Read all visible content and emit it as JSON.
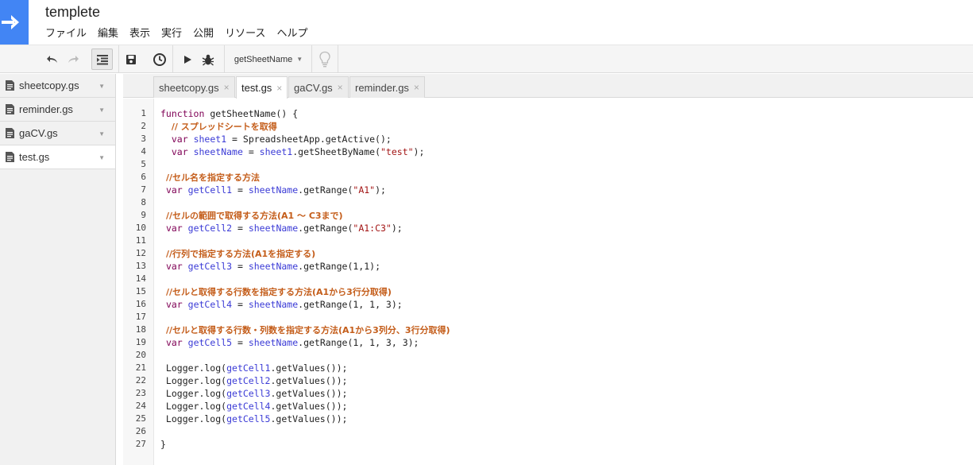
{
  "app": {
    "title": "templete",
    "colors": {
      "brand": "#4285f4",
      "comment": "#c45d1a",
      "keyword": "#7f0055",
      "variable": "#3b3bd6",
      "string": "#a31515"
    }
  },
  "menu": [
    "ファイル",
    "編集",
    "表示",
    "実行",
    "公開",
    "リソース",
    "ヘルプ"
  ],
  "toolbar": {
    "function_select": "getSheetName",
    "icons": [
      "undo-icon",
      "redo-icon",
      "indent-icon",
      "save-icon",
      "triggers-icon",
      "run-icon",
      "debug-icon",
      "lightbulb-icon"
    ]
  },
  "sidebar": {
    "files": [
      {
        "name": "sheetcopy.gs"
      },
      {
        "name": "reminder.gs"
      },
      {
        "name": "gaCV.gs"
      },
      {
        "name": "test.gs"
      }
    ],
    "active_index": 3
  },
  "tabs": [
    {
      "label": "sheetcopy.gs",
      "close": "×"
    },
    {
      "label": "test.gs",
      "close": "×"
    },
    {
      "label": "gaCV.gs",
      "close": "×"
    },
    {
      "label": "reminder.gs",
      "close": "×"
    }
  ],
  "active_tab": 1,
  "code": [
    [
      [
        "kw",
        "function"
      ],
      [
        "t",
        " getSheetName() {"
      ]
    ],
    [
      [
        "t",
        "  "
      ],
      [
        "c",
        "// スプレッドシートを取得"
      ]
    ],
    [
      [
        "t",
        "  "
      ],
      [
        "kw",
        "var"
      ],
      [
        "t",
        " "
      ],
      [
        "v",
        "sheet1"
      ],
      [
        "t",
        " = SpreadsheetApp.getActive();"
      ]
    ],
    [
      [
        "t",
        "  "
      ],
      [
        "kw",
        "var"
      ],
      [
        "t",
        " "
      ],
      [
        "v",
        "sheetName"
      ],
      [
        "t",
        " = "
      ],
      [
        "v",
        "sheet1"
      ],
      [
        "t",
        ".getSheetByName("
      ],
      [
        "s",
        "\"test\""
      ],
      [
        "t",
        ");"
      ]
    ],
    [
      [
        "t",
        ""
      ]
    ],
    [
      [
        "t",
        " "
      ],
      [
        "c",
        "//セル名を指定する方法"
      ]
    ],
    [
      [
        "t",
        " "
      ],
      [
        "kw",
        "var"
      ],
      [
        "t",
        " "
      ],
      [
        "v",
        "getCell1"
      ],
      [
        "t",
        " = "
      ],
      [
        "v",
        "sheetName"
      ],
      [
        "t",
        ".getRange("
      ],
      [
        "s",
        "\"A1\""
      ],
      [
        "t",
        ");"
      ]
    ],
    [
      [
        "t",
        ""
      ]
    ],
    [
      [
        "t",
        " "
      ],
      [
        "c",
        "//セルの範囲で取得する方法(A1 〜 C3まで)"
      ]
    ],
    [
      [
        "t",
        " "
      ],
      [
        "kw",
        "var"
      ],
      [
        "t",
        " "
      ],
      [
        "v",
        "getCell2"
      ],
      [
        "t",
        " = "
      ],
      [
        "v",
        "sheetName"
      ],
      [
        "t",
        ".getRange("
      ],
      [
        "s",
        "\"A1:C3\""
      ],
      [
        "t",
        ");"
      ]
    ],
    [
      [
        "t",
        ""
      ]
    ],
    [
      [
        "t",
        " "
      ],
      [
        "c",
        "//行列で指定する方法(A1を指定する)"
      ]
    ],
    [
      [
        "t",
        " "
      ],
      [
        "kw",
        "var"
      ],
      [
        "t",
        " "
      ],
      [
        "v",
        "getCell3"
      ],
      [
        "t",
        " = "
      ],
      [
        "v",
        "sheetName"
      ],
      [
        "t",
        ".getRange(1,1);"
      ]
    ],
    [
      [
        "t",
        ""
      ]
    ],
    [
      [
        "t",
        " "
      ],
      [
        "c",
        "//セルと取得する行数を指定する方法(A1から3行分取得)"
      ]
    ],
    [
      [
        "t",
        " "
      ],
      [
        "kw",
        "var"
      ],
      [
        "t",
        " "
      ],
      [
        "v",
        "getCell4"
      ],
      [
        "t",
        " = "
      ],
      [
        "v",
        "sheetName"
      ],
      [
        "t",
        ".getRange(1, 1, 3);"
      ]
    ],
    [
      [
        "t",
        ""
      ]
    ],
    [
      [
        "t",
        " "
      ],
      [
        "c",
        "//セルと取得する行数・列数を指定する方法(A1から3列分、3行分取得)"
      ]
    ],
    [
      [
        "t",
        " "
      ],
      [
        "kw",
        "var"
      ],
      [
        "t",
        " "
      ],
      [
        "v",
        "getCell5"
      ],
      [
        "t",
        " = "
      ],
      [
        "v",
        "sheetName"
      ],
      [
        "t",
        ".getRange(1, 1, 3, 3);"
      ]
    ],
    [
      [
        "t",
        ""
      ]
    ],
    [
      [
        "t",
        " Logger.log("
      ],
      [
        "v",
        "getCell1"
      ],
      [
        "t",
        ".getValues());"
      ]
    ],
    [
      [
        "t",
        " Logger.log("
      ],
      [
        "v",
        "getCell2"
      ],
      [
        "t",
        ".getValues());"
      ]
    ],
    [
      [
        "t",
        " Logger.log("
      ],
      [
        "v",
        "getCell3"
      ],
      [
        "t",
        ".getValues());"
      ]
    ],
    [
      [
        "t",
        " Logger.log("
      ],
      [
        "v",
        "getCell4"
      ],
      [
        "t",
        ".getValues());"
      ]
    ],
    [
      [
        "t",
        " Logger.log("
      ],
      [
        "v",
        "getCell5"
      ],
      [
        "t",
        ".getValues());"
      ]
    ],
    [
      [
        "t",
        ""
      ]
    ],
    [
      [
        "t",
        "}"
      ]
    ]
  ]
}
